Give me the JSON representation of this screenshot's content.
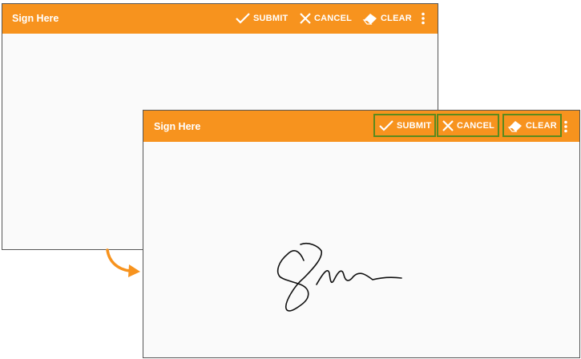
{
  "colors": {
    "toolbar": "#f7931e",
    "highlight": "#5a8a1e",
    "arrow": "#f7931e",
    "ink": "#111111"
  },
  "back_window": {
    "title": "Sign Here",
    "buttons": {
      "submit": "SUBMIT",
      "cancel": "CANCEL",
      "clear": "CLEAR"
    },
    "icons": [
      "check-icon",
      "close-icon",
      "eraser-icon",
      "more-vert-icon"
    ]
  },
  "front_window": {
    "title": "Sign Here",
    "buttons": {
      "submit": "SUBMIT",
      "cancel": "CANCEL",
      "clear": "CLEAR"
    },
    "icons": [
      "check-icon",
      "close-icon",
      "eraser-icon",
      "more-vert-icon"
    ],
    "highlighted_buttons": [
      "submit",
      "cancel",
      "clear"
    ],
    "signature_present": true
  },
  "arrow_icon": "curved-arrow-icon"
}
